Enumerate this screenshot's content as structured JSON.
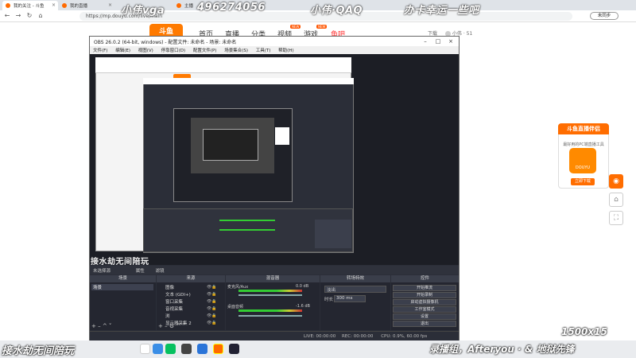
{
  "browser": {
    "tabs": [
      {
        "label": "我的关注 - 斗鱼"
      },
      {
        "label": "我的直播"
      },
      {
        "label": "主播"
      }
    ],
    "url": "https://mp.douyu.com/live/main",
    "login_label": "未同步"
  },
  "site": {
    "logo": "斗鱼",
    "nav": [
      {
        "label": "首页"
      },
      {
        "label": "直播"
      },
      {
        "label": "分类"
      },
      {
        "label": "视频"
      },
      {
        "label": "游戏"
      },
      {
        "label": "鱼吧"
      }
    ],
    "badges": [
      "NEW",
      "NEW"
    ],
    "download_label": "下载",
    "user_label": "小伟 · 51"
  },
  "watermark": {
    "top": [
      "小伟vga",
      "496274056",
      "小伟·QAQ",
      "办卡幸运一些吧"
    ],
    "bottom_left": "接水劫无间陪玩",
    "bottom_right": "录播组，Afteryou · & 地狱先锋",
    "corner": "1500x15"
  },
  "obs": {
    "title": "OBS 26.0.2 (64-bit, windows) - 配置文件: 未命名 - 场景: 未命名",
    "menu": [
      "文件(F)",
      "编辑(E)",
      "视图(V)",
      "停靠窗口(D)",
      "配置文件(P)",
      "场景集合(S)",
      "工具(T)",
      "帮助(H)"
    ],
    "scene_overlay": "接水劫无间陪玩",
    "toolstrip": [
      "未选择源",
      "属性",
      "滤镜"
    ],
    "docks": {
      "scenes": "场景",
      "sources": "来源",
      "mixer": "混音器",
      "transitions": "转场特效",
      "controls": "控件"
    },
    "scene_list": [
      "场景"
    ],
    "sources_list": [
      "图像",
      "文本 (GDI+)",
      "窗口采集",
      "音视采集",
      "浏",
      "显示器采集 2"
    ],
    "mixer": [
      {
        "name": "麦克风/Aux",
        "db": "0.0 dB"
      },
      {
        "name": "桌面音频",
        "db": "-1.6 dB"
      }
    ],
    "transition": {
      "type": "淡出",
      "duration_label": "时长",
      "duration": "300 ms"
    },
    "controls": [
      "开始推流",
      "开始录制",
      "启动虚拟摄像机",
      "工作室模式",
      "设置",
      "退出"
    ],
    "status": {
      "live": "LIVE: 00:00:00",
      "rec": "REC: 00:00:00",
      "cpu": "CPU: 0.9%, 60.00 fps"
    }
  },
  "promo": {
    "title": "斗鱼直播伴侣",
    "subtitle": "最好用的PC端直播工具",
    "icon_label": "DOUYU",
    "button": "立即下载"
  },
  "colors": {
    "accent": "#ff6d00",
    "obs_bg": "#2b2e38",
    "chrome_bg": "#dfe3e8"
  }
}
